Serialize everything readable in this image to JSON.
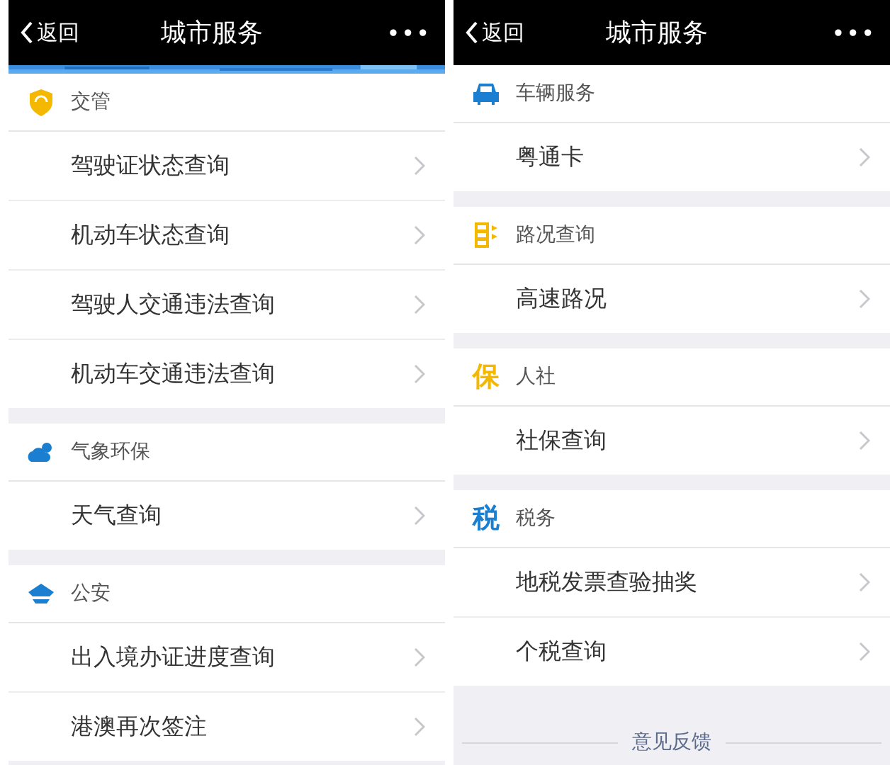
{
  "panels": [
    {
      "nav": {
        "back": "返回",
        "title": "城市服务",
        "more": "•••"
      },
      "banner": {
        "kind": "picture"
      },
      "sections": [
        {
          "title": "交管",
          "kind": "shield",
          "color": "#f5b800",
          "items": [
            "驾驶证状态查询",
            "机动车状态查询",
            "驾驶人交通违法查询",
            "机动车交通违法查询"
          ]
        },
        {
          "title": "气象环保",
          "kind": "weather",
          "color": "#1a7fd0",
          "items": [
            "天气查询"
          ]
        },
        {
          "title": "公安",
          "kind": "cap",
          "color": "#1a7fd0",
          "items": [
            "出入境办证进度查询",
            "港澳再次签注"
          ]
        }
      ]
    },
    {
      "nav": {
        "back": "返回",
        "title": "城市服务",
        "more": "•••"
      },
      "sections": [
        {
          "title": "车辆服务",
          "kind": "car",
          "color": "#1a7fd0",
          "items": [
            "粤通卡"
          ]
        },
        {
          "title": "路况查询",
          "kind": "traffic",
          "color": "#f5b800",
          "items": [
            "高速路况"
          ]
        },
        {
          "title": "人社",
          "kind": "glyph",
          "glyph": "保",
          "color": "#f5b800",
          "items": [
            "社保查询"
          ]
        },
        {
          "title": "税务",
          "kind": "glyph",
          "glyph": "税",
          "color": "#1a7fd0",
          "items": [
            "地税发票查验抽奖",
            "个税查询"
          ]
        }
      ],
      "footer": {
        "link": "意见反馈"
      }
    }
  ]
}
